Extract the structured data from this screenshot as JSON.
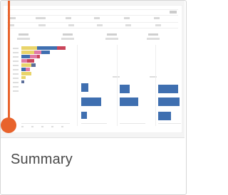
{
  "card": {
    "title": "Summary"
  },
  "colors": {
    "accent": "#e8632c",
    "bar_blue": "#3f6fb0",
    "bar_yellow": "#e9d46a",
    "bar_pink": "#e07aa6",
    "bar_red": "#c9455a",
    "bar_slate": "#5c6f9a"
  },
  "icons": {
    "thumbnail": "dashboard-preview-icon",
    "accent": "selection-marker-icon"
  }
}
